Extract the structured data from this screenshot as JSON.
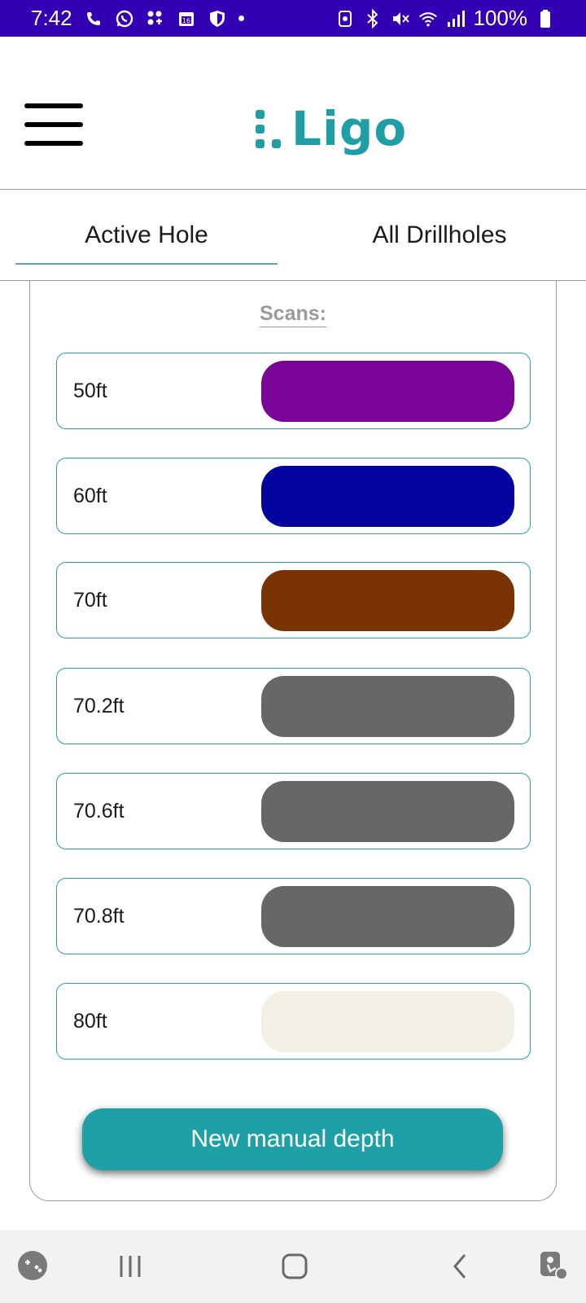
{
  "status_bar": {
    "time": "7:42",
    "battery": "100%",
    "left_icons": [
      "phone-icon",
      "whatsapp-icon",
      "apps-icon",
      "calendar-icon",
      "shield-icon",
      "dot-icon"
    ],
    "right_icons": [
      "nfc-icon",
      "bluetooth-icon",
      "mute-icon",
      "wifi-icon",
      "signal-icon",
      "battery-icon"
    ]
  },
  "header": {
    "logo_text": "Ligo",
    "menu_icon": "hamburger-menu-icon"
  },
  "tabs": [
    {
      "label": "Active Hole",
      "active": true
    },
    {
      "label": "All Drillholes",
      "active": false
    }
  ],
  "scans": {
    "title": "Scans:",
    "items": [
      {
        "depth": "50ft",
        "color": "#7a0497"
      },
      {
        "depth": "60ft",
        "color": "#03049d"
      },
      {
        "depth": "70ft",
        "color": "#7a3302"
      },
      {
        "depth": "70.2ft",
        "color": "#676767"
      },
      {
        "depth": "70.6ft",
        "color": "#676767"
      },
      {
        "depth": "70.8ft",
        "color": "#676767"
      },
      {
        "depth": "80ft",
        "color": "#f3f0e6"
      }
    ]
  },
  "actions": {
    "new_manual_depth": "New manual depth"
  },
  "colors": {
    "status_bar": "#3300b3",
    "accent": "#1fa0a6",
    "row_border": "#2aa0a8",
    "nav_background": "#f2f2f2"
  },
  "bottom_nav": [
    "game-launcher-icon",
    "recent-apps-icon",
    "home-icon",
    "back-icon",
    "accessibility-icon"
  ]
}
